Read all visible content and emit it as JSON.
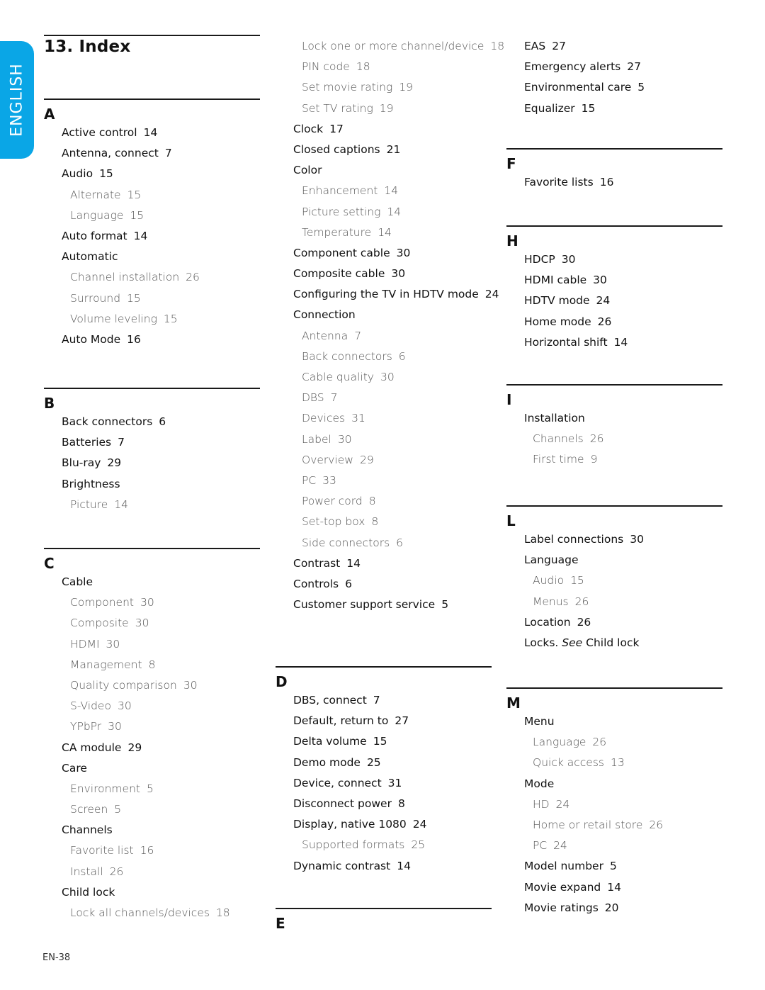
{
  "language_tab": "ENGLISH",
  "title": "13.  Index",
  "page_number": "EN-38",
  "sections": {
    "A": {
      "letter": "A",
      "entries": [
        {
          "text": "Active control",
          "page": "14",
          "level": "main"
        },
        {
          "text": "Antenna, connect",
          "page": "7",
          "level": "main"
        },
        {
          "text": "Audio",
          "page": "15",
          "level": "main"
        },
        {
          "text": "Alternate",
          "page": "15",
          "level": "sub"
        },
        {
          "text": "Language",
          "page": "15",
          "level": "sub"
        },
        {
          "text": "Auto format",
          "page": "14",
          "level": "main"
        },
        {
          "text": "Automatic",
          "page": "",
          "level": "main"
        },
        {
          "text": "Channel installation",
          "page": "26",
          "level": "sub"
        },
        {
          "text": "Surround",
          "page": "15",
          "level": "sub"
        },
        {
          "text": "Volume leveling",
          "page": "15",
          "level": "sub"
        },
        {
          "text": "Auto Mode",
          "page": "16",
          "level": "main"
        }
      ]
    },
    "B": {
      "letter": "B",
      "entries": [
        {
          "text": "Back connectors",
          "page": "6",
          "level": "main"
        },
        {
          "text": "Batteries",
          "page": "7",
          "level": "main"
        },
        {
          "text": "Blu-ray",
          "page": "29",
          "level": "main"
        },
        {
          "text": "Brightness",
          "page": "",
          "level": "main"
        },
        {
          "text": "Picture",
          "page": "14",
          "level": "sub"
        }
      ]
    },
    "C": {
      "letter": "C",
      "entries_col1": [
        {
          "text": "Cable",
          "page": "",
          "level": "main"
        },
        {
          "text": "Component",
          "page": "30",
          "level": "sub"
        },
        {
          "text": "Composite",
          "page": "30",
          "level": "sub"
        },
        {
          "text": "HDMI",
          "page": "30",
          "level": "sub"
        },
        {
          "text": "Management",
          "page": "8",
          "level": "sub"
        },
        {
          "text": "Quality comparison",
          "page": "30",
          "level": "sub"
        },
        {
          "text": "S-Video",
          "page": "30",
          "level": "sub"
        },
        {
          "text": "YPbPr",
          "page": "30",
          "level": "sub"
        },
        {
          "text": "CA module",
          "page": "29",
          "level": "main"
        },
        {
          "text": "Care",
          "page": "",
          "level": "main"
        },
        {
          "text": "Environment",
          "page": "5",
          "level": "sub"
        },
        {
          "text": "Screen",
          "page": "5",
          "level": "sub"
        },
        {
          "text": "Channels",
          "page": "",
          "level": "main"
        },
        {
          "text": "Favorite list",
          "page": "16",
          "level": "sub"
        },
        {
          "text": "Install",
          "page": "26",
          "level": "sub"
        },
        {
          "text": "Child lock",
          "page": "",
          "level": "main"
        },
        {
          "text": "Lock all channels/devices",
          "page": "18",
          "level": "sub"
        }
      ],
      "entries_col2": [
        {
          "text": "Lock one or more channel/device",
          "page": "18",
          "level": "sub"
        },
        {
          "text": "PIN code",
          "page": "18",
          "level": "sub"
        },
        {
          "text": "Set movie rating",
          "page": "19",
          "level": "sub"
        },
        {
          "text": "Set TV rating",
          "page": "19",
          "level": "sub"
        },
        {
          "text": "Clock",
          "page": "17",
          "level": "main"
        },
        {
          "text": "Closed captions",
          "page": "21",
          "level": "main"
        },
        {
          "text": "Color",
          "page": "",
          "level": "main"
        },
        {
          "text": "Enhancement",
          "page": "14",
          "level": "sub"
        },
        {
          "text": "Picture setting",
          "page": "14",
          "level": "sub"
        },
        {
          "text": "Temperature",
          "page": "14",
          "level": "sub"
        },
        {
          "text": "Component cable",
          "page": "30",
          "level": "main"
        },
        {
          "text": "Composite cable",
          "page": "30",
          "level": "main"
        },
        {
          "text": "Configuring the TV in HDTV mode",
          "page": "24",
          "level": "main"
        },
        {
          "text": "Connection",
          "page": "",
          "level": "main"
        },
        {
          "text": "Antenna",
          "page": "7",
          "level": "sub"
        },
        {
          "text": "Back connectors",
          "page": "6",
          "level": "sub"
        },
        {
          "text": "Cable quality",
          "page": "30",
          "level": "sub"
        },
        {
          "text": "DBS",
          "page": "7",
          "level": "sub"
        },
        {
          "text": "Devices",
          "page": "31",
          "level": "sub"
        },
        {
          "text": "Label",
          "page": "30",
          "level": "sub"
        },
        {
          "text": "Overview",
          "page": "29",
          "level": "sub"
        },
        {
          "text": "PC",
          "page": "33",
          "level": "sub"
        },
        {
          "text": "Power cord",
          "page": "8",
          "level": "sub"
        },
        {
          "text": "Set-top box",
          "page": "8",
          "level": "sub"
        },
        {
          "text": "Side connectors",
          "page": "6",
          "level": "sub"
        },
        {
          "text": "Contrast",
          "page": "14",
          "level": "main"
        },
        {
          "text": "Controls",
          "page": "6",
          "level": "main"
        },
        {
          "text": "Customer support service",
          "page": "5",
          "level": "main"
        }
      ]
    },
    "D": {
      "letter": "D",
      "entries": [
        {
          "text": "DBS, connect",
          "page": "7",
          "level": "main"
        },
        {
          "text": "Default, return to",
          "page": "27",
          "level": "main"
        },
        {
          "text": "Delta volume",
          "page": "15",
          "level": "main"
        },
        {
          "text": "Demo mode",
          "page": "25",
          "level": "main"
        },
        {
          "text": "Device, connect",
          "page": "31",
          "level": "main"
        },
        {
          "text": "Disconnect power",
          "page": "8",
          "level": "main"
        },
        {
          "text": "Display, native 1080",
          "page": "24",
          "level": "main"
        },
        {
          "text": "Supported formats",
          "page": "25",
          "level": "sub"
        },
        {
          "text": "Dynamic contrast",
          "page": "14",
          "level": "main"
        }
      ]
    },
    "E": {
      "letter": "E",
      "entries": [
        {
          "text": "EAS",
          "page": "27",
          "level": "main"
        },
        {
          "text": "Emergency alerts",
          "page": "27",
          "level": "main"
        },
        {
          "text": "Environmental care",
          "page": "5",
          "level": "main"
        },
        {
          "text": "Equalizer",
          "page": "15",
          "level": "main"
        }
      ]
    },
    "F": {
      "letter": "F",
      "entries": [
        {
          "text": "Favorite lists",
          "page": "16",
          "level": "main"
        }
      ]
    },
    "H": {
      "letter": "H",
      "entries": [
        {
          "text": "HDCP",
          "page": "30",
          "level": "main"
        },
        {
          "text": "HDMI cable",
          "page": "30",
          "level": "main"
        },
        {
          "text": "HDTV mode",
          "page": "24",
          "level": "main"
        },
        {
          "text": "Home mode",
          "page": "26",
          "level": "main"
        },
        {
          "text": "Horizontal shift",
          "page": "14",
          "level": "main"
        }
      ]
    },
    "I": {
      "letter": "I",
      "entries": [
        {
          "text": "Installation",
          "page": "",
          "level": "main"
        },
        {
          "text": "Channels",
          "page": "26",
          "level": "sub"
        },
        {
          "text": "First time",
          "page": "9",
          "level": "sub"
        }
      ]
    },
    "L": {
      "letter": "L",
      "entries": [
        {
          "text": "Label connections",
          "page": "30",
          "level": "main"
        },
        {
          "text": "Language",
          "page": "",
          "level": "main"
        },
        {
          "text": "Audio",
          "page": "15",
          "level": "sub"
        },
        {
          "text": "Menus",
          "page": "26",
          "level": "sub"
        },
        {
          "text": "Location",
          "page": "26",
          "level": "main"
        },
        {
          "text": "Locks.",
          "page": "",
          "level": "main",
          "see": "See",
          "see_target": "Child lock"
        }
      ]
    },
    "M": {
      "letter": "M",
      "entries": [
        {
          "text": "Menu",
          "page": "",
          "level": "main"
        },
        {
          "text": "Language",
          "page": "26",
          "level": "sub"
        },
        {
          "text": "Quick access",
          "page": "13",
          "level": "sub"
        },
        {
          "text": "Mode",
          "page": "",
          "level": "main"
        },
        {
          "text": "HD",
          "page": "24",
          "level": "sub"
        },
        {
          "text": "Home or retail store",
          "page": "26",
          "level": "sub"
        },
        {
          "text": "PC",
          "page": "24",
          "level": "sub"
        },
        {
          "text": "Model number",
          "page": "5",
          "level": "main"
        },
        {
          "text": "Movie expand",
          "page": "14",
          "level": "main"
        },
        {
          "text": "Movie ratings",
          "page": "20",
          "level": "main"
        }
      ]
    }
  },
  "colors": {
    "language_tab": "#0aa6e6",
    "main_entry": "#111111",
    "sub_entry": "#555555"
  }
}
